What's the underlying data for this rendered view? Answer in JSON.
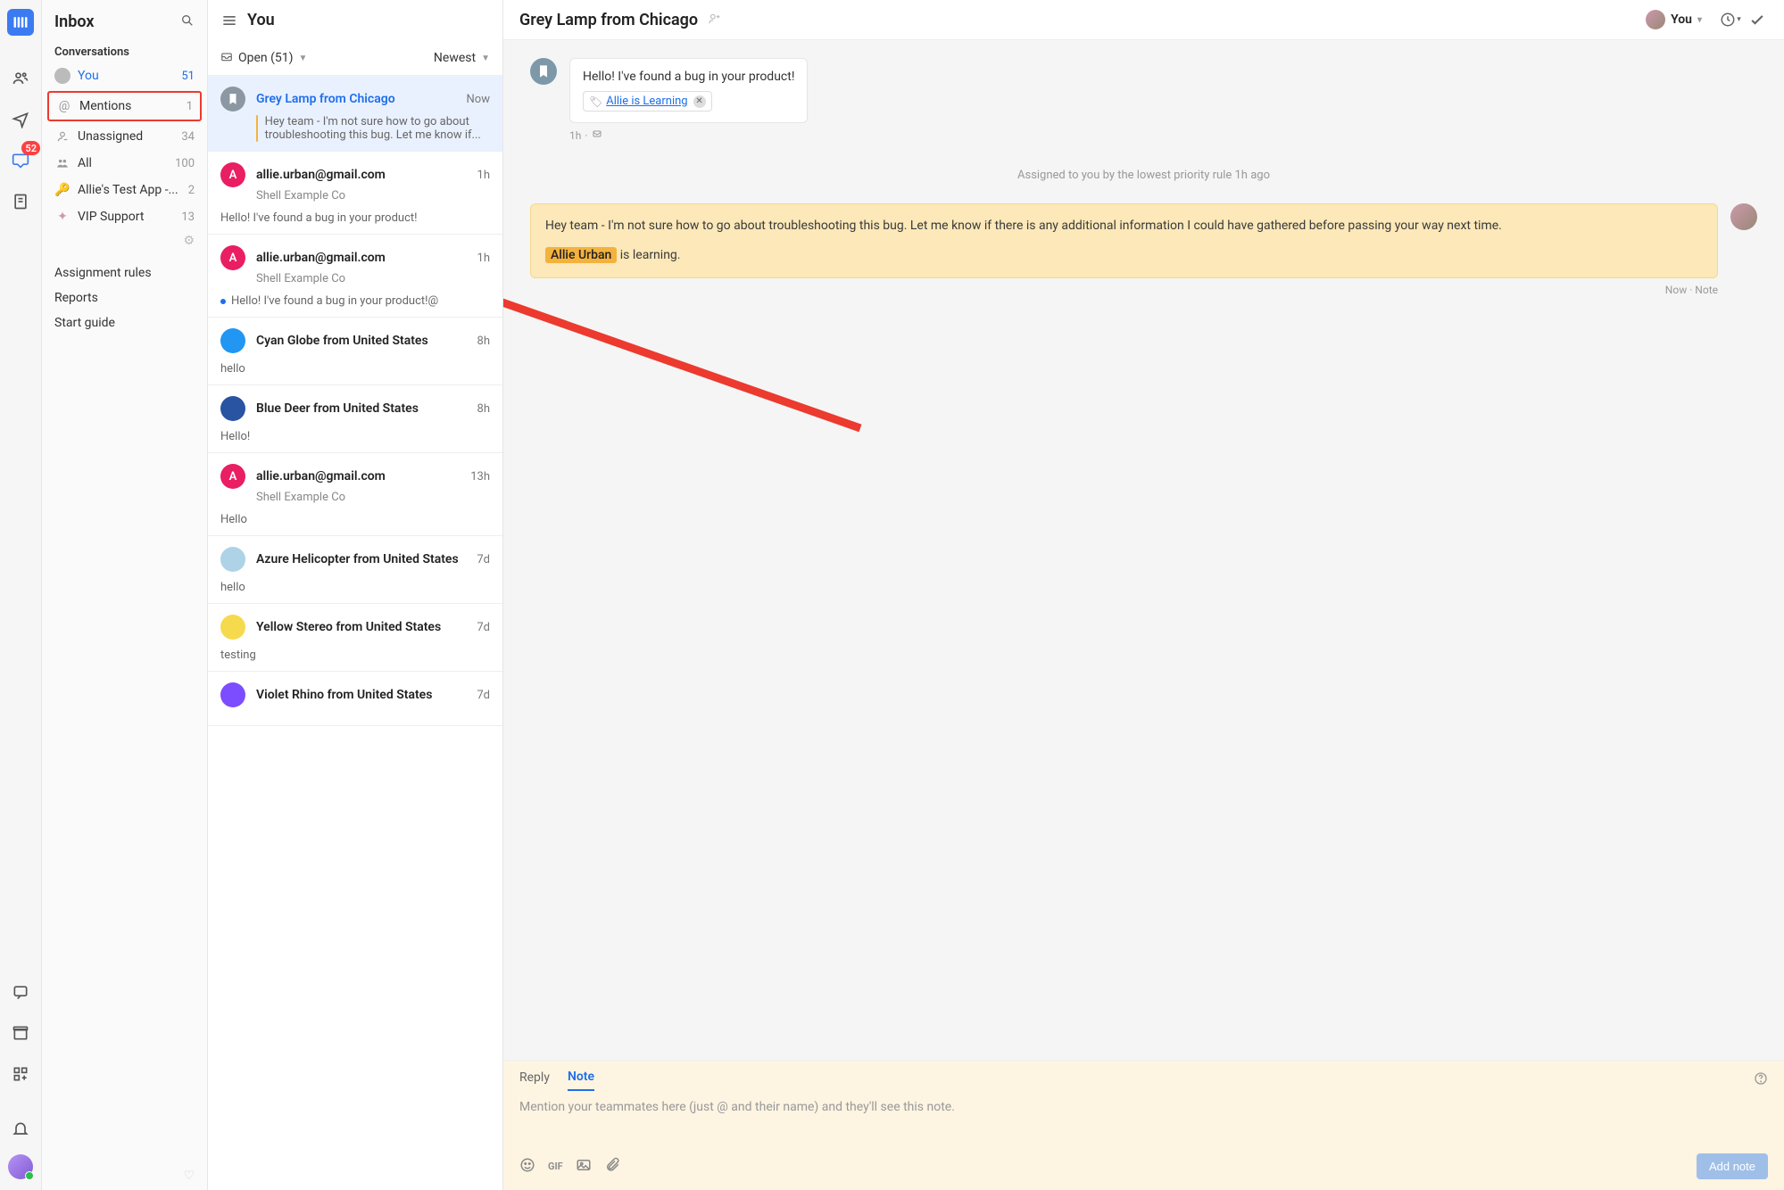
{
  "rail": {
    "badge": "52"
  },
  "sidebar": {
    "title": "Inbox",
    "section": "Conversations",
    "items": [
      {
        "label": "You",
        "count": "51",
        "kind": "avatar",
        "active": true
      },
      {
        "label": "Mentions",
        "count": "1",
        "kind": "mention",
        "highlighted": true
      },
      {
        "label": "Unassigned",
        "count": "34",
        "kind": "unassigned"
      },
      {
        "label": "All",
        "count": "100",
        "kind": "people"
      },
      {
        "label": "Allie's Test App -...",
        "count": "2",
        "kind": "key"
      },
      {
        "label": "VIP Support",
        "count": "13",
        "kind": "sparkle"
      }
    ],
    "links": [
      "Assignment rules",
      "Reports",
      "Start guide"
    ]
  },
  "list": {
    "title": "You",
    "filter_label": "Open (51)",
    "sort_label": "Newest",
    "items": [
      {
        "from": "Grey Lamp from Chicago",
        "time": "Now",
        "sub": "",
        "preview": "Hey team - I'm not sure how to go about troubleshooting this bug. Let me know if...",
        "avatar": "c-gray",
        "initial": "",
        "selected": true,
        "flag": true
      },
      {
        "from": "allie.urban@gmail.com",
        "time": "1h",
        "sub": "Shell Example Co",
        "preview": "Hello! I've found a bug in your product!",
        "avatar": "c-pink",
        "initial": "A"
      },
      {
        "from": "allie.urban@gmail.com",
        "time": "1h",
        "sub": "Shell Example Co",
        "preview": "Hello! I've found a bug in your product!@",
        "avatar": "c-pink",
        "initial": "A",
        "unread": true
      },
      {
        "from": "Cyan Globe from United States",
        "time": "8h",
        "sub": "",
        "preview": "hello",
        "avatar": "c-blue",
        "initial": ""
      },
      {
        "from": "Blue Deer from United States",
        "time": "8h",
        "sub": "",
        "preview": "Hello!",
        "avatar": "c-navy",
        "initial": ""
      },
      {
        "from": "allie.urban@gmail.com",
        "time": "13h",
        "sub": "Shell Example Co",
        "preview": "Hello",
        "avatar": "c-pink",
        "initial": "A"
      },
      {
        "from": "Azure Helicopter from United States",
        "time": "7d",
        "sub": "",
        "preview": "hello",
        "avatar": "c-teal",
        "initial": ""
      },
      {
        "from": "Yellow Stereo from United States",
        "time": "7d",
        "sub": "",
        "preview": "testing",
        "avatar": "c-yellow",
        "initial": ""
      },
      {
        "from": "Violet Rhino from United States",
        "time": "7d",
        "sub": "",
        "preview": "",
        "avatar": "c-purple",
        "initial": ""
      }
    ]
  },
  "main": {
    "title": "Grey Lamp from Chicago",
    "owner": "You",
    "first_message": "Hello! I've found a bug in your product!",
    "tag_label": "Allie is Learning",
    "first_meta": "1h",
    "assigned_line": "Assigned to you by the lowest priority rule 1h ago",
    "note_body": "Hey team - I'm not sure how to go about troubleshooting this bug. Let me know if there is any additional information I could have gathered before passing your way next time.",
    "mention_name": "Allie Urban",
    "mention_tail": " is learning.",
    "note_meta": "Now · Note"
  },
  "composer": {
    "tab_reply": "Reply",
    "tab_note": "Note",
    "placeholder": "Mention your teammates here (just @ and their name) and they'll see this note.",
    "gif_label": "GIF",
    "submit": "Add note"
  }
}
